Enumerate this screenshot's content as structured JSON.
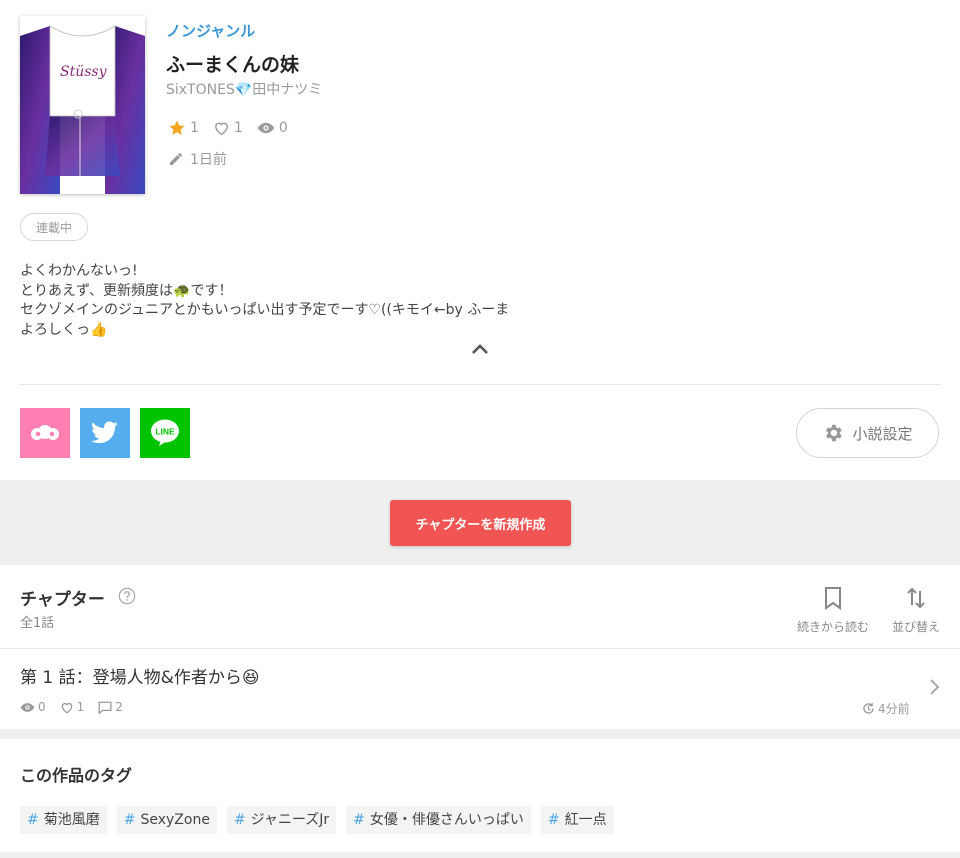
{
  "novel": {
    "genre": "ノンジャンル",
    "title": "ふーまくんの妹",
    "author": "SixTONES💎田中ナツミ",
    "stats": {
      "stars": "1",
      "likes": "1",
      "views": "0"
    },
    "updated": "1日前",
    "status": "連載中",
    "cover_logo_text": "Stüssy",
    "description": [
      "よくわかんないっ!",
      "とりあえず、更新頻度は🐢です！",
      "セクゾメインのジュニアとかもいっぱい出す予定でーす♡((キモイ←by ふーま",
      "よろしくっ👍"
    ]
  },
  "actions": {
    "settings_label": "小説設定",
    "create_chapter_label": "チャプターを新規作成"
  },
  "chapters_section": {
    "title": "チャプター",
    "count": "全1話",
    "resume_label": "続きから読む",
    "sort_label": "並び替え",
    "items": [
      {
        "title": "第 1 話：登場人物&作者から😆",
        "views": "0",
        "likes": "1",
        "comments": "2",
        "time": "4分前"
      }
    ]
  },
  "tags_section": {
    "title": "この作品のタグ",
    "tags": [
      "菊池風磨",
      "SexyZone",
      "ジャニーズJr",
      "女優・俳優さんいっぱい",
      "紅一点"
    ]
  },
  "colors": {
    "accent_blue": "#3a98d8",
    "create_button": "#f05453",
    "share_pink": "#ff7fb3",
    "twitter_blue": "#55acee",
    "line_green": "#00c300",
    "star": "#f5a623"
  },
  "icons": [
    "star-icon",
    "heart-icon",
    "eye-icon",
    "pencil-icon",
    "chevron-up-icon",
    "gear-icon",
    "help-icon",
    "bookmark-icon",
    "sort-icon",
    "comment-icon",
    "clock-icon",
    "chevron-right-icon",
    "twitter-icon",
    "line-icon"
  ]
}
